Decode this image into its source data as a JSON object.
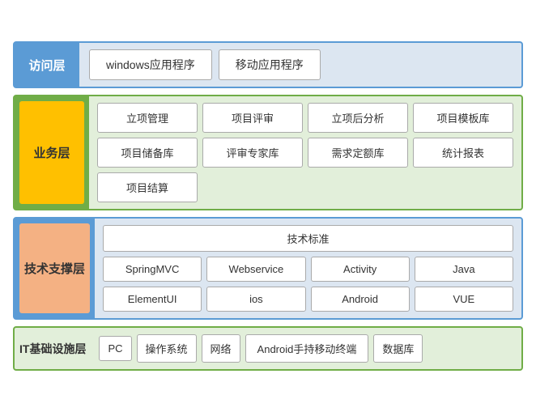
{
  "layers": {
    "access": {
      "label": "访问层",
      "items": [
        "windows应用程序",
        "移动应用程序"
      ]
    },
    "business": {
      "label": "业务层",
      "items": [
        "立项管理",
        "项目评审",
        "立项后分析",
        "项目模板库",
        "项目储备库",
        "评审专家库",
        "需求定额库",
        "统计报表",
        "项目结算"
      ]
    },
    "tech": {
      "label": "技术支撑层",
      "standard": "技术标准",
      "row1": [
        "SpringMVC",
        "Webservice",
        "Activity",
        "Java"
      ],
      "row2": [
        "ElementUI",
        "ios",
        "Android",
        "VUE"
      ]
    },
    "infra": {
      "label": "IT基础设施层",
      "items": [
        "PC",
        "操作系统",
        "网络",
        "Android手持移动终端",
        "数据库"
      ]
    }
  }
}
